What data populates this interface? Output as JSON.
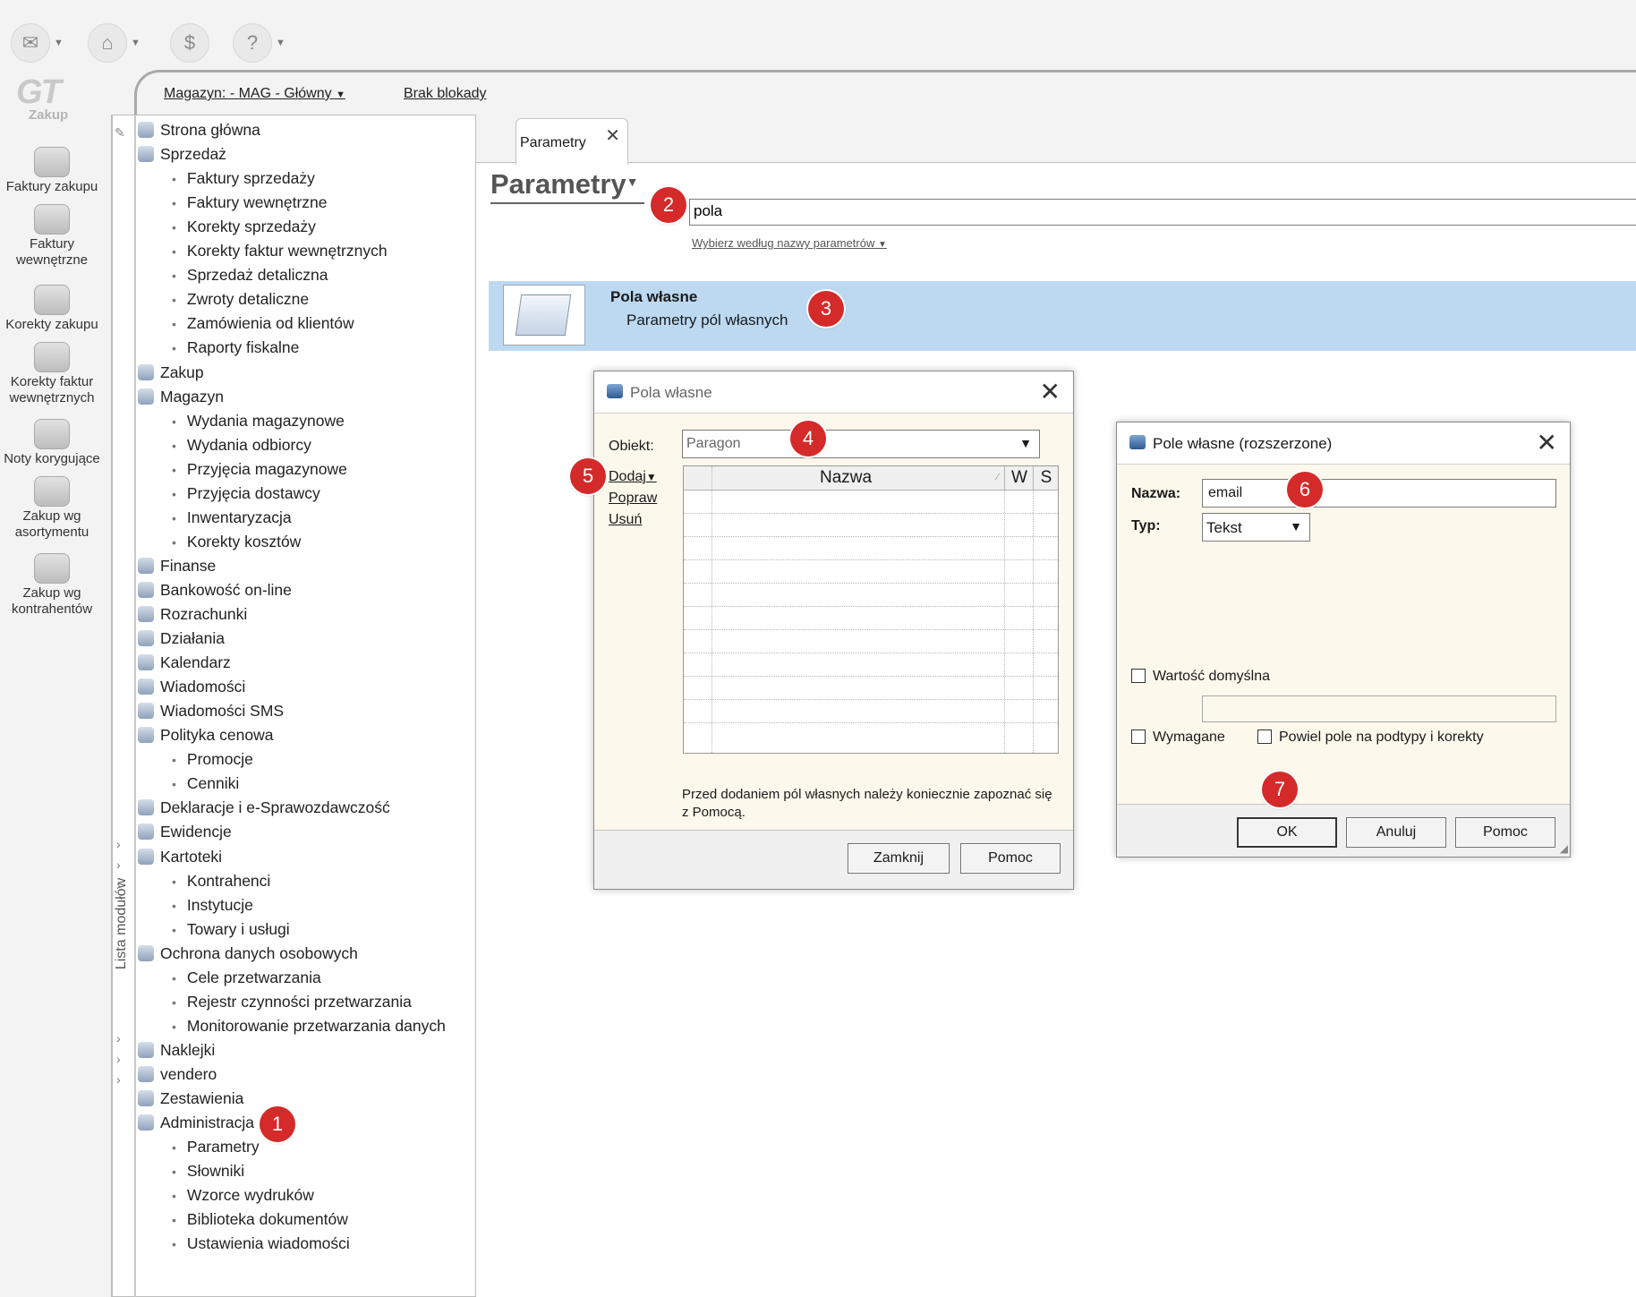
{
  "toolbar": {
    "icons": [
      "send-receive-icon",
      "inbox-icon",
      "dollar-icon",
      "help-icon"
    ]
  },
  "app": {
    "logo_text": "GT",
    "module": "Zakup"
  },
  "left_buttons": [
    {
      "label": "Faktury zakupu"
    },
    {
      "label": "Faktury wewnętrzne"
    },
    {
      "label": "Korekty zakupu"
    },
    {
      "label": "Korekty faktur wewnętrznych"
    },
    {
      "label": "Noty korygujące"
    },
    {
      "label": "Zakup wg asortymentu"
    },
    {
      "label": "Zakup wg kontrahentów"
    }
  ],
  "header": {
    "warehouse": "Magazyn: - MAG - Główny",
    "lock_status": "Brak blokady"
  },
  "tree": {
    "side_tab": "Lista modułów",
    "items": [
      {
        "label": "Strona główna",
        "level": 0
      },
      {
        "label": "Sprzedaż",
        "level": 0
      },
      {
        "label": "Faktury sprzedaży",
        "level": 1
      },
      {
        "label": "Faktury wewnętrzne",
        "level": 1
      },
      {
        "label": "Korekty sprzedaży",
        "level": 1
      },
      {
        "label": "Korekty faktur wewnętrznych",
        "level": 1
      },
      {
        "label": "Sprzedaż detaliczna",
        "level": 1
      },
      {
        "label": "Zwroty detaliczne",
        "level": 1
      },
      {
        "label": "Zamówienia od klientów",
        "level": 1
      },
      {
        "label": "Raporty fiskalne",
        "level": 1
      },
      {
        "label": "Zakup",
        "level": 0
      },
      {
        "label": "Magazyn",
        "level": 0
      },
      {
        "label": "Wydania magazynowe",
        "level": 1
      },
      {
        "label": "Wydania odbiorcy",
        "level": 1
      },
      {
        "label": "Przyjęcia magazynowe",
        "level": 1
      },
      {
        "label": "Przyjęcia dostawcy",
        "level": 1
      },
      {
        "label": "Inwentaryzacja",
        "level": 1
      },
      {
        "label": "Korekty kosztów",
        "level": 1
      },
      {
        "label": "Finanse",
        "level": 0
      },
      {
        "label": "Bankowość on-line",
        "level": 0
      },
      {
        "label": "Rozrachunki",
        "level": 0
      },
      {
        "label": "Działania",
        "level": 0
      },
      {
        "label": "Kalendarz",
        "level": 0
      },
      {
        "label": "Wiadomości",
        "level": 0
      },
      {
        "label": "Wiadomości SMS",
        "level": 0
      },
      {
        "label": "Polityka cenowa",
        "level": 0
      },
      {
        "label": "Promocje",
        "level": 1
      },
      {
        "label": "Cenniki",
        "level": 1
      },
      {
        "label": "Deklaracje i e-Sprawozdawczość",
        "level": 0
      },
      {
        "label": "Ewidencje",
        "level": 0
      },
      {
        "label": "Kartoteki",
        "level": 0
      },
      {
        "label": "Kontrahenci",
        "level": 1
      },
      {
        "label": "Instytucje",
        "level": 1
      },
      {
        "label": "Towary i usługi",
        "level": 1
      },
      {
        "label": "Ochrona danych osobowych",
        "level": 0
      },
      {
        "label": "Cele przetwarzania",
        "level": 1
      },
      {
        "label": "Rejestr czynności przetwarzania",
        "level": 1
      },
      {
        "label": "Monitorowanie przetwarzania danych",
        "level": 1
      },
      {
        "label": "Naklejki",
        "level": 0
      },
      {
        "label": "vendero",
        "level": 0
      },
      {
        "label": "Zestawienia",
        "level": 0
      },
      {
        "label": "Administracja",
        "level": 0
      },
      {
        "label": "Parametry",
        "level": 1
      },
      {
        "label": "Słowniki",
        "level": 1
      },
      {
        "label": "Wzorce wydruków",
        "level": 1
      },
      {
        "label": "Biblioteka dokumentów",
        "level": 1
      },
      {
        "label": "Ustawienia wiadomości",
        "level": 1
      }
    ]
  },
  "main": {
    "tab_label": "Parametry",
    "tab_close": "✕",
    "page_title": "Parametry",
    "search_value": "pola",
    "select_by": "Wybierz według nazwy parametrów",
    "result_title": "Pola własne",
    "result_subtitle": "Parametry pól własnych"
  },
  "dialog_fields": {
    "title": "Pola własne",
    "object_label": "Obiekt:",
    "object_value": "Paragon",
    "add": "Dodaj",
    "edit": "Popraw",
    "delete": "Usuń",
    "col_name": "Nazwa",
    "col_w": "W",
    "col_s": "S",
    "note": "Przed dodaniem pól własnych należy koniecznie zapoznać się z Pomocą.",
    "close_button": "Zamknij",
    "help_button": "Pomoc"
  },
  "dialog_field": {
    "title": "Pole własne (rozszerzone)",
    "name_label": "Nazwa:",
    "name_value": "email",
    "type_label": "Typ:",
    "type_value": "Tekst",
    "default_label": "Wartość domyślna",
    "default_checked": false,
    "required_label": "Wymagane",
    "required_checked": false,
    "copy_label": "Powiel pole na podtypy i korekty",
    "copy_checked": false,
    "ok": "OK",
    "cancel": "Anuluj",
    "help": "Pomoc"
  },
  "markers": [
    "1",
    "2",
    "3",
    "4",
    "5",
    "6",
    "7"
  ],
  "colors": {
    "highlight": "#bcd9f1",
    "marker": "#d42a2a",
    "dialog_body": "#fdf8ec"
  }
}
